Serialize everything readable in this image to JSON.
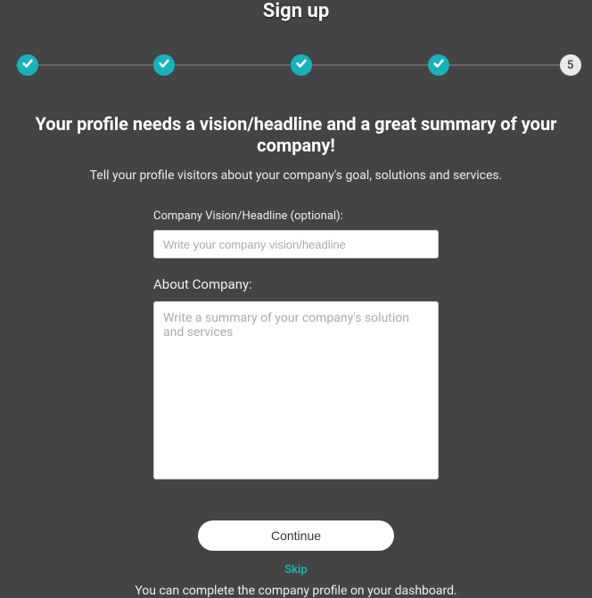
{
  "title": "Sign up",
  "stepper": {
    "steps": [
      {
        "state": "done"
      },
      {
        "state": "done"
      },
      {
        "state": "done"
      },
      {
        "state": "done"
      },
      {
        "state": "current",
        "label": "5"
      }
    ]
  },
  "headline": "Your profile needs a vision/headline and a great summary of your company!",
  "subhead": "Tell your profile visitors about your company's goal, solutions and services.",
  "form": {
    "vision_label": "Company Vision/Headline (optional):",
    "vision_placeholder": "Write your company vision/headline",
    "about_label": "About Company:",
    "about_placeholder": "Write a summary of your company's solution and services"
  },
  "actions": {
    "continue": "Continue",
    "skip": "Skip"
  },
  "footer": "You can complete the company profile on your dashboard."
}
